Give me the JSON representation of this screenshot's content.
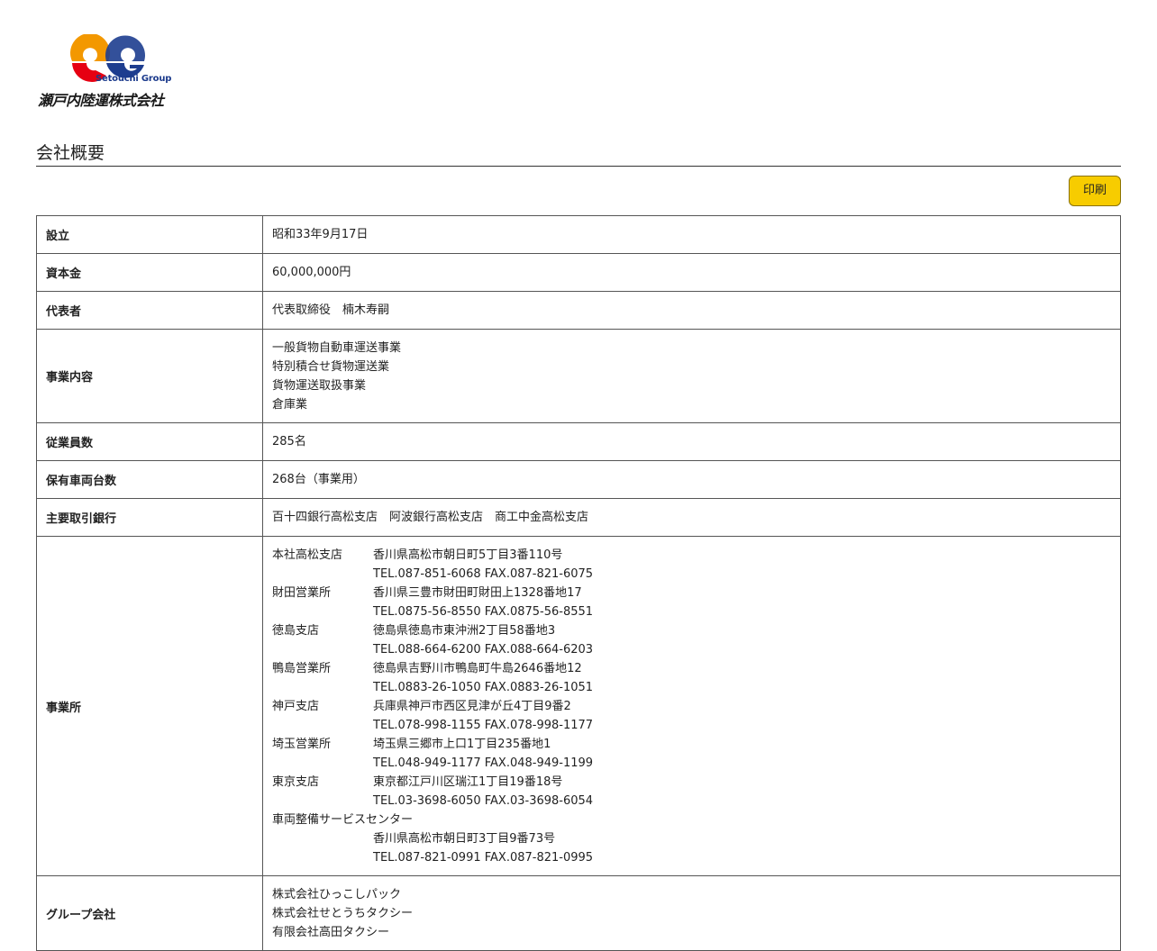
{
  "logo": {
    "en": "Setouchi Group",
    "jp": "瀬戸内陸運株式会社",
    "colors": {
      "orange": "#f39800",
      "red": "#e60012",
      "blue": "#1d3d8f"
    }
  },
  "page_title": "会社概要",
  "print_button": "印刷",
  "button_color": "#f7cc00",
  "rows": {
    "established": {
      "label": "設立",
      "value": "昭和33年9月17日"
    },
    "capital": {
      "label": "資本金",
      "value": "60,000,000円"
    },
    "representative": {
      "label": "代表者",
      "value": "代表取締役　楠木寿嗣"
    },
    "business": {
      "label": "事業内容",
      "lines": [
        "一般貨物自動車運送事業",
        "特別積合せ貨物運送業",
        "貨物運送取扱事業",
        "倉庫業"
      ]
    },
    "employees": {
      "label": "従業員数",
      "value": "285名"
    },
    "vehicles": {
      "label": "保有車両台数",
      "value": "268台（事業用）"
    },
    "banks": {
      "label": "主要取引銀行",
      "value": "百十四銀行高松支店　阿波銀行高松支店　商工中金高松支店"
    },
    "offices": {
      "label": "事業所",
      "items": [
        {
          "name": "本社高松支店",
          "address": "香川県高松市朝日町5丁目3番110号",
          "tel": "TEL.087-851-6068 FAX.087-821-6075"
        },
        {
          "name": "財田営業所",
          "address": "香川県三豊市財田町財田上1328番地17",
          "tel": "TEL.0875-56-8550 FAX.0875-56-8551"
        },
        {
          "name": "徳島支店",
          "address": "徳島県徳島市東沖洲2丁目58番地3",
          "tel": "TEL.088-664-6200 FAX.088-664-6203"
        },
        {
          "name": "鴨島営業所",
          "address": "徳島県吉野川市鴨島町牛島2646番地12",
          "tel": "TEL.0883-26-1050 FAX.0883-26-1051"
        },
        {
          "name": "神戸支店",
          "address": "兵庫県神戸市西区見津が丘4丁目9番2",
          "tel": "TEL.078-998-1155 FAX.078-998-1177"
        },
        {
          "name": "埼玉営業所",
          "address": "埼玉県三郷市上口1丁目235番地1",
          "tel": "TEL.048-949-1177 FAX.048-949-1199"
        },
        {
          "name": "東京支店",
          "address": "東京都江戸川区瑞江1丁目19番18号",
          "tel": "TEL.03-3698-6050 FAX.03-3698-6054"
        }
      ],
      "service_center": {
        "name": "車両整備サービスセンター",
        "address": "香川県高松市朝日町3丁目9番73号",
        "tel": "TEL.087-821-0991 FAX.087-821-0995"
      }
    },
    "group": {
      "label": "グループ会社",
      "lines": [
        "株式会社ひっこしパック",
        "株式会社せとうちタクシー",
        "有限会社高田タクシー"
      ]
    }
  }
}
